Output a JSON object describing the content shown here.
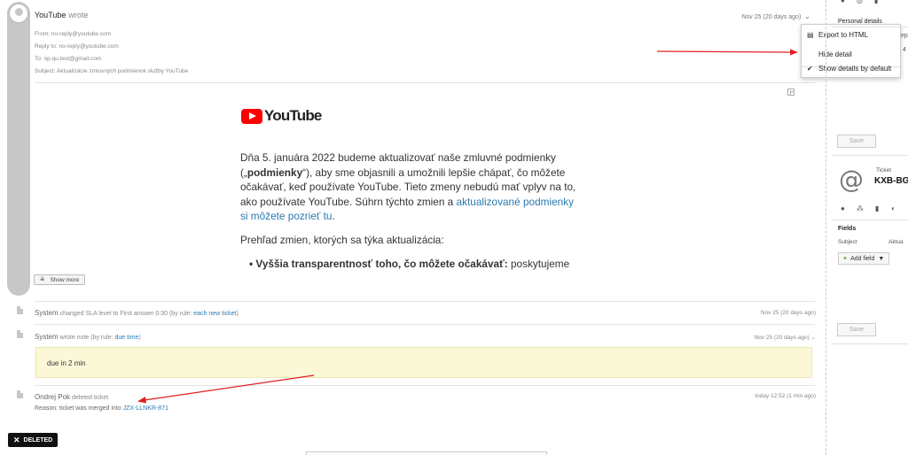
{
  "email": {
    "sender": "YouTube",
    "wrote": "wrote",
    "date": "Nov 25 (20 days ago)",
    "from": "From: no-reply@youtube.com",
    "reply_to": "Reply to: no-reply@youtube.com",
    "to": "To: op.qu.test@gmail.com",
    "subject": "Subject: Aktualizácie zmluvných podmienok služby YouTube",
    "logo_text": "YouTube",
    "para1_a": "Dňa 5. januára 2022 budeme aktualizovať naše zmluvné podmienky („",
    "para1_bold": "podmienky",
    "para1_b": "“), aby sme objasnili a umožnili lepšie chápať, čo môžete očakávať, keď používate YouTube. Tieto zmeny nebudú mať vplyv na to, ako používate YouTube. Súhrn týchto zmien a ",
    "para1_link": "aktualizované podmienky si môžete pozrieť tu",
    "para1_end": ".",
    "para2": "Prehľad zmien, ktorých sa týka aktualizácia:",
    "bullet_bold": "Vyššia transparentnosť toho, čo môžete očakávať:",
    "bullet_rest": " poskytujeme",
    "show_more": "Show more"
  },
  "menu": {
    "items": [
      {
        "icon": "export-icon",
        "label": "Export to HTML"
      },
      {
        "icon": "",
        "label": "Hide detail"
      },
      {
        "icon": "check-icon",
        "label": "Show details by default"
      }
    ]
  },
  "events": [
    {
      "who": "System",
      "text": "changed SLA level to First answer 0:30 (by rule: ",
      "link": "each new ticket",
      "end": ")",
      "date": "Nov 25 (20 days ago)"
    },
    {
      "who": "System",
      "text": "wrote note (by rule: ",
      "link": "due time",
      "end": ")",
      "date": "Nov 25 (20 days ago)"
    },
    {
      "who": "Ondrej Pok",
      "text": "deleted ticket",
      "link": "",
      "end": "",
      "date": "today 12:52 (1 min ago)"
    }
  ],
  "note": "due in 2 min",
  "reason_prefix": "Reason: ticket was merged into ",
  "reason_link": "JZX-LLNKR-871",
  "deleted_badge": "DELETED",
  "right_panel": {
    "personal_details": "Personal details",
    "save": "Save",
    "ticket_label": "Ticket",
    "ticket_id": "KXB-BG",
    "fields": "Fields",
    "subject_label": "Subject",
    "subject_value": "Aktua",
    "add_field": "Add field",
    "save2": "Save",
    "peek_1": "ep",
    "peek_2": "4"
  },
  "colors": {
    "accent_link": "#2a7ab0",
    "youtube_red": "#ff0000",
    "note_bg": "#fbf8d8",
    "arrow": "#e02020"
  }
}
